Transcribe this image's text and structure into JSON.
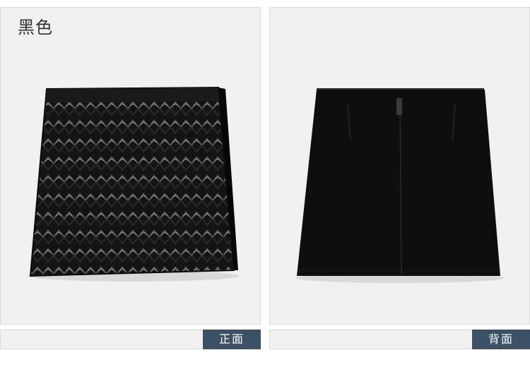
{
  "color_label": "黑色",
  "views": {
    "front_label": "正面",
    "back_label": "背面"
  },
  "colors": {
    "panel_bg": "#f1f1f1",
    "tag_bg": "#3c5066",
    "skirt": "#0c0c0c"
  }
}
